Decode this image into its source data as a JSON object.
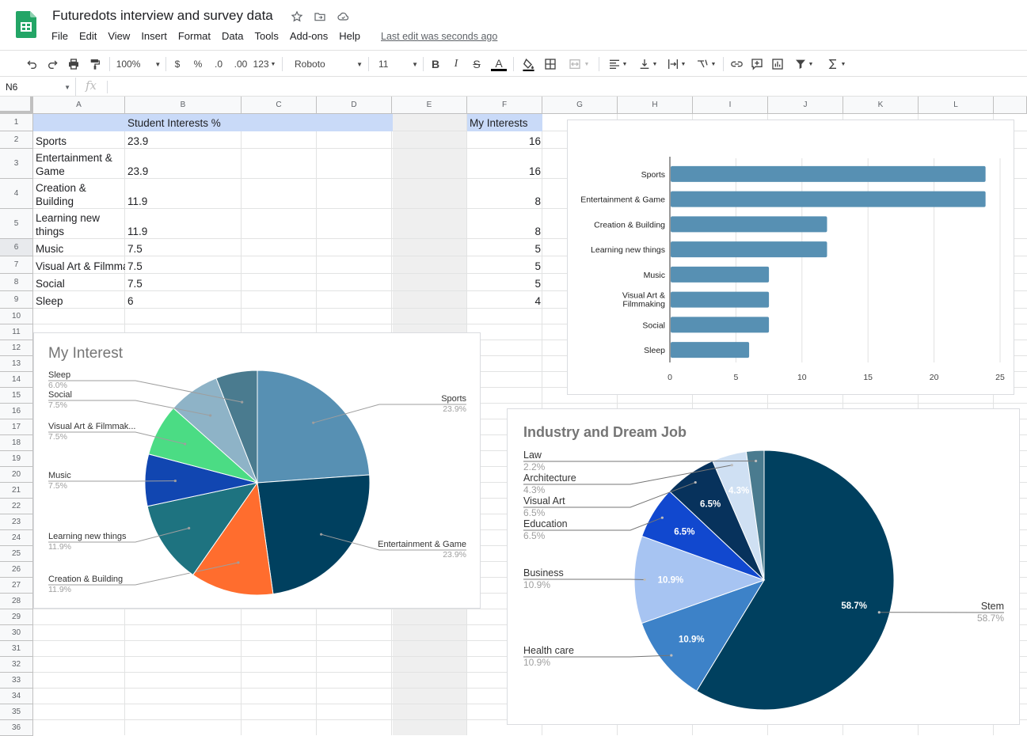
{
  "app": {
    "doc_title": "Futuredots interview and survey data",
    "menu": [
      "File",
      "Edit",
      "View",
      "Insert",
      "Format",
      "Data",
      "Tools",
      "Add-ons",
      "Help"
    ],
    "last_edit": "Last edit was seconds ago"
  },
  "toolbar": {
    "zoom": "100%",
    "currency": "$",
    "percent": "%",
    "decimal_decrease": ".0",
    "decimal_increase": ".00",
    "more_formats": "123",
    "font": "Roboto",
    "font_size": "11",
    "bold": "B",
    "italic": "I",
    "strike": "S",
    "text_color": "A"
  },
  "formula_bar": {
    "cell_ref": "N6",
    "fx": "fx",
    "value": ""
  },
  "sheet": {
    "columns": [
      "A",
      "B",
      "C",
      "D",
      "E",
      "F",
      "G",
      "H",
      "I",
      "J",
      "K",
      "L"
    ],
    "rows": [
      "1",
      "2",
      "3",
      "4",
      "5",
      "6",
      "7",
      "8",
      "9",
      "10",
      "11",
      "12",
      "13",
      "14",
      "15",
      "16",
      "17",
      "18",
      "19",
      "20",
      "21",
      "22",
      "23",
      "24",
      "25",
      "26",
      "27",
      "28",
      "29",
      "30",
      "31",
      "32",
      "33",
      "34",
      "35",
      "36"
    ],
    "header_b": "Student Interests %",
    "header_f": "My Interests",
    "data": [
      {
        "a": [
          "Sports"
        ],
        "b": "23.9",
        "f": "16"
      },
      {
        "a": [
          "Entertainment &",
          "Game"
        ],
        "b": "23.9",
        "f": "16"
      },
      {
        "a": [
          "Creation &",
          "Building"
        ],
        "b": "11.9",
        "f": "8"
      },
      {
        "a": [
          "Learning new",
          "things"
        ],
        "b": "11.9",
        "f": "8"
      },
      {
        "a": [
          "Music"
        ],
        "b": "7.5",
        "f": "5"
      },
      {
        "a": [
          "Visual Art & Filmmak"
        ],
        "b": "7.5",
        "f": "5"
      },
      {
        "a": [
          "Social"
        ],
        "b": "7.5",
        "f": "5"
      },
      {
        "a": [
          "Sleep"
        ],
        "b": "6",
        "f": "4"
      }
    ]
  },
  "chart_data": [
    {
      "type": "pie",
      "title": "My Interest",
      "categories": [
        "Sports",
        "Entertainment & Game",
        "Creation & Building",
        "Learning new things",
        "Music",
        "Visual Art & Filmmak...",
        "Social",
        "Sleep"
      ],
      "values": [
        16,
        16,
        8,
        8,
        5,
        5,
        5,
        4
      ],
      "labels": [
        "23.9%",
        "23.9%",
        "11.9%",
        "11.9%",
        "7.5%",
        "7.5%",
        "7.5%",
        "6.0%"
      ],
      "colors": [
        "#5790b3",
        "#00405f",
        "#ff6d2e",
        "#1e7380",
        "#1146b1",
        "#4bdc84",
        "#8eb3c7",
        "#4a7b8f"
      ],
      "legend": "leader-lines"
    },
    {
      "type": "bar",
      "orientation": "horizontal",
      "categories": [
        "Sports",
        "Entertainment & Game",
        "Creation & Building",
        "Learning new things",
        "Music",
        "Visual Art & Filmmaking",
        "Social",
        "Sleep"
      ],
      "values": [
        23.9,
        23.9,
        11.9,
        11.9,
        7.5,
        7.5,
        7.5,
        6
      ],
      "xlim": [
        0,
        25
      ],
      "xticks": [
        "0",
        "5",
        "10",
        "15",
        "20",
        "25"
      ],
      "color": "#5790b3",
      "grid": true
    },
    {
      "type": "pie",
      "title": "Industry and Dream Job",
      "categories": [
        "Stem",
        "Health care",
        "Business",
        "Education",
        "Visual Art",
        "Architecture",
        "Law"
      ],
      "values": [
        58.7,
        10.9,
        10.9,
        6.5,
        6.5,
        4.3,
        2.2
      ],
      "labels": [
        "58.7%",
        "10.9%",
        "10.9%",
        "6.5%",
        "6.5%",
        "4.3%",
        "2.2%"
      ],
      "colors": [
        "#00405f",
        "#3d82c8",
        "#a7c4f2",
        "#1148cf",
        "#07325c",
        "#cfe0f3",
        "#4a7b8f"
      ],
      "legend": "leader-lines"
    }
  ]
}
